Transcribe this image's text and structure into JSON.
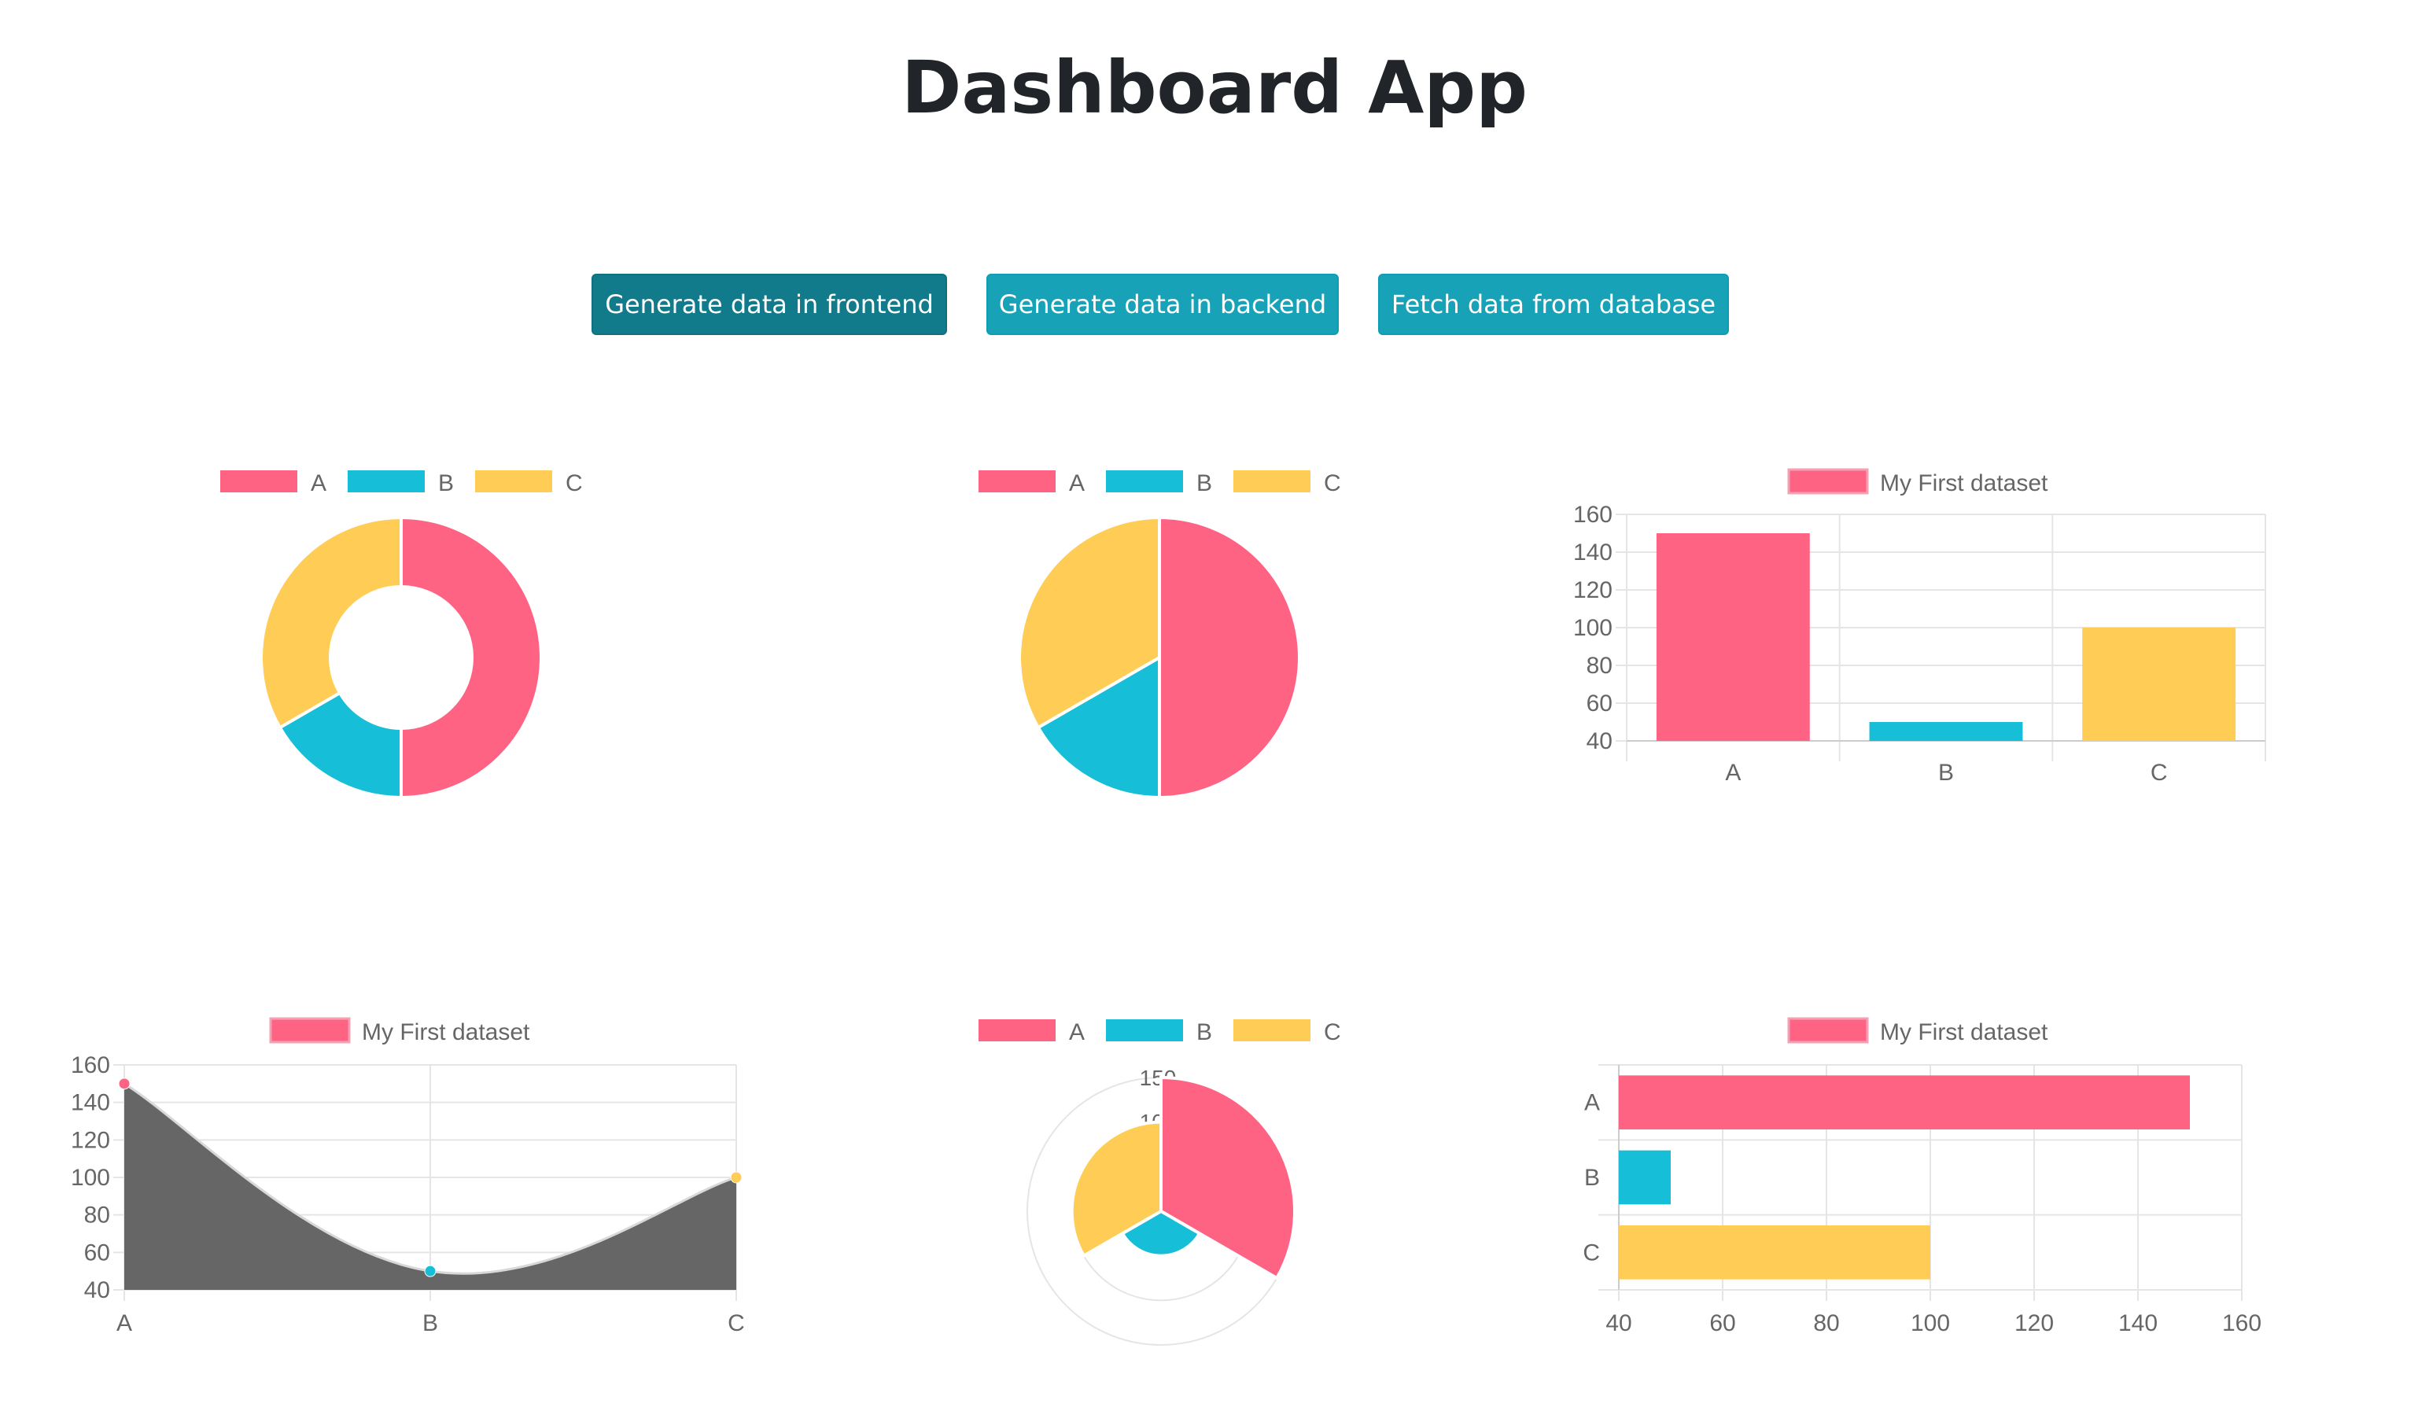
{
  "page": {
    "title": "Dashboard App"
  },
  "buttons": [
    {
      "label": "Generate data in frontend",
      "active": true
    },
    {
      "label": "Generate data in backend",
      "active": false
    },
    {
      "label": "Fetch data from database",
      "active": false
    }
  ],
  "colors": {
    "A": "#ff6384",
    "B": "#17bed7",
    "C": "#ffcd56",
    "line_fill": "#666666",
    "grid": "#e5e5e5"
  },
  "chart_data": [
    {
      "type": "pie",
      "variant": "doughnut",
      "legend": [
        "A",
        "B",
        "C"
      ],
      "values": [
        150,
        50,
        100
      ]
    },
    {
      "type": "pie",
      "legend": [
        "A",
        "B",
        "C"
      ],
      "values": [
        150,
        50,
        100
      ]
    },
    {
      "type": "bar",
      "orientation": "vertical",
      "legend": [
        "My First dataset"
      ],
      "categories": [
        "A",
        "B",
        "C"
      ],
      "values": [
        150,
        50,
        100
      ],
      "ylim": [
        40,
        160
      ],
      "yticks": [
        "40",
        "60",
        "80",
        "100",
        "120",
        "140",
        "160"
      ],
      "grid": true
    },
    {
      "type": "area",
      "legend": [
        "My First dataset"
      ],
      "categories": [
        "A",
        "B",
        "C"
      ],
      "values": [
        150,
        50,
        100
      ],
      "ylim": [
        40,
        160
      ],
      "yticks": [
        "40",
        "60",
        "80",
        "100",
        "120",
        "140",
        "160"
      ],
      "grid": true
    },
    {
      "type": "polarArea",
      "legend": [
        "A",
        "B",
        "C"
      ],
      "values": [
        150,
        50,
        100
      ],
      "rticks": [
        "150",
        "100"
      ]
    },
    {
      "type": "bar",
      "orientation": "horizontal",
      "legend": [
        "My First dataset"
      ],
      "categories": [
        "A",
        "B",
        "C"
      ],
      "values": [
        150,
        50,
        100
      ],
      "xlim": [
        40,
        160
      ],
      "xticks": [
        "40",
        "60",
        "80",
        "100",
        "120",
        "140",
        "160"
      ],
      "grid": true
    }
  ]
}
